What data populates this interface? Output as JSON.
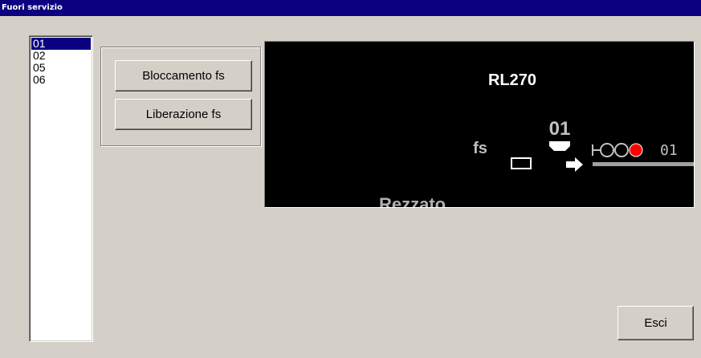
{
  "window": {
    "title": "Fuori servizio"
  },
  "list": {
    "items": [
      "01",
      "02",
      "05",
      "06"
    ],
    "selected_index": 0
  },
  "buttons": {
    "block_label": "Bloccamento fs",
    "release_label": "Liberazione fs",
    "exit_label": "Esci"
  },
  "diagram": {
    "line_label": "RL270",
    "fs_label": "fs",
    "signal_number": "01",
    "signal_label": "01",
    "station_label": "Rezzato",
    "signal_state_color": "#ff0000"
  }
}
